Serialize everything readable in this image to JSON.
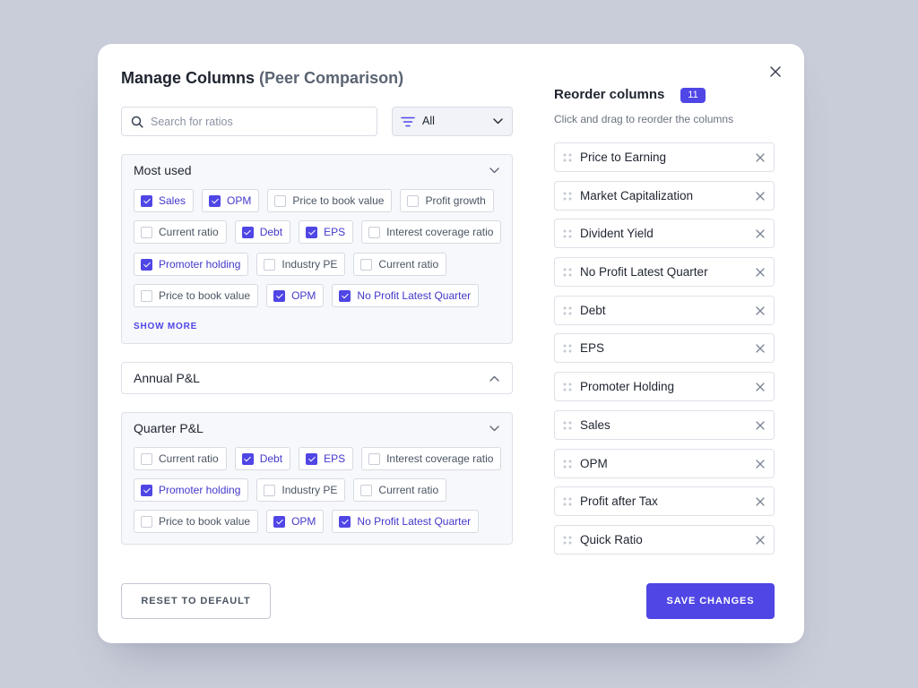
{
  "theme": {
    "accent": "#4f46e5",
    "backdrop": "#c9cdd9",
    "surface": "#ffffff"
  },
  "modal": {
    "title": "Manage Columns",
    "subtitle": "(Peer Comparison)",
    "close_icon": "close-icon"
  },
  "search": {
    "placeholder": "Search for ratios",
    "icon": "search-icon"
  },
  "filter": {
    "icon": "filter-icon",
    "selected": "All",
    "dropdown_icon": "chevron-down-icon"
  },
  "sections": [
    {
      "title": "Most used",
      "expanded": true,
      "toggle_icon": "chevron-down-icon",
      "chips": [
        {
          "label": "Sales",
          "checked": true
        },
        {
          "label": "OPM",
          "checked": true
        },
        {
          "label": "Price to book value",
          "checked": false
        },
        {
          "label": "Profit growth",
          "checked": false
        },
        {
          "label": "Current ratio",
          "checked": false
        },
        {
          "label": "Debt",
          "checked": true
        },
        {
          "label": "EPS",
          "checked": true
        },
        {
          "label": "Interest coverage ratio",
          "checked": false
        },
        {
          "label": "Promoter holding",
          "checked": true
        },
        {
          "label": "Industry PE",
          "checked": false
        },
        {
          "label": "Current ratio",
          "checked": false
        },
        {
          "label": "Price to book value",
          "checked": false
        },
        {
          "label": "OPM",
          "checked": true
        },
        {
          "label": "No Profit Latest Quarter",
          "checked": true
        }
      ],
      "show_more": "SHOW MORE"
    },
    {
      "title": "Annual P&L",
      "expanded": false,
      "toggle_icon": "chevron-up-icon"
    },
    {
      "title": "Quarter P&L",
      "expanded": true,
      "toggle_icon": "chevron-down-icon",
      "chips": [
        {
          "label": "Current ratio",
          "checked": false
        },
        {
          "label": "Debt",
          "checked": true
        },
        {
          "label": "EPS",
          "checked": true
        },
        {
          "label": "Interest coverage ratio",
          "checked": false
        },
        {
          "label": "Promoter holding",
          "checked": true
        },
        {
          "label": "Industry PE",
          "checked": false
        },
        {
          "label": "Current ratio",
          "checked": false
        },
        {
          "label": "Price to book value",
          "checked": false
        },
        {
          "label": "OPM",
          "checked": true
        },
        {
          "label": "No Profit Latest Quarter",
          "checked": true
        }
      ]
    }
  ],
  "reorder": {
    "title": "Reorder columns",
    "count": "11",
    "hint": "Click and drag to reorder the columns",
    "drag_icon": "drag-handle-icon",
    "remove_icon": "close-icon",
    "items": [
      "Price to Earning",
      "Market Capitalization",
      "Divident Yield",
      "No Profit Latest Quarter",
      "Debt",
      "EPS",
      "Promoter Holding",
      "Sales",
      "OPM",
      "Profit after Tax",
      "Quick Ratio"
    ]
  },
  "actions": {
    "reset": "RESET TO DEFAULT",
    "save": "SAVE CHANGES"
  }
}
